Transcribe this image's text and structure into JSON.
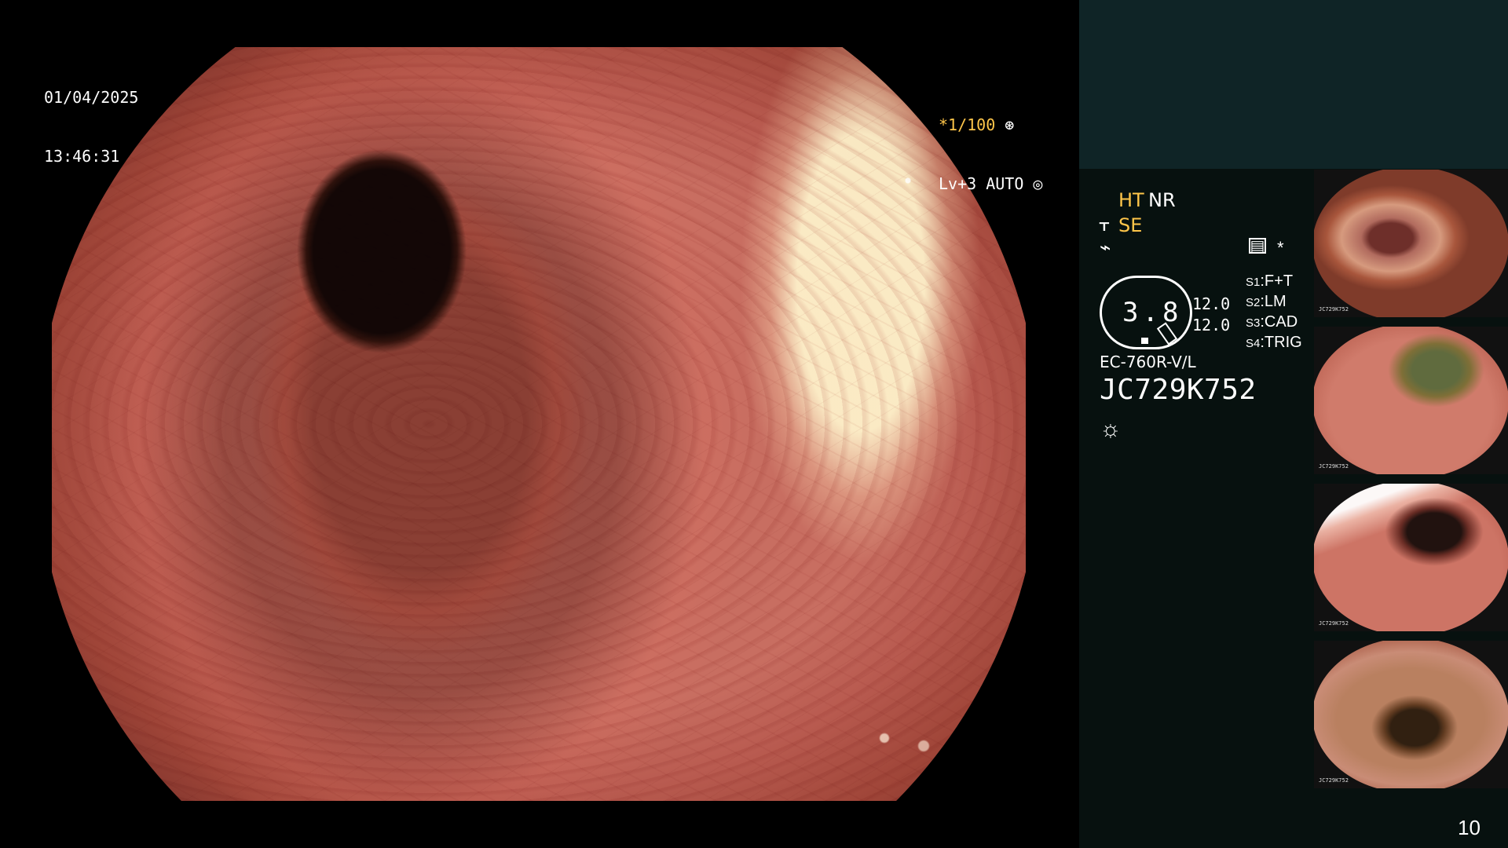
{
  "overlay": {
    "date": "01/04/2025",
    "time": "13:46:31",
    "exposure": "*1/100",
    "mode": "Lv+3 AUTO"
  },
  "status": {
    "ht": "HT",
    "nr": "NR",
    "se": "SE",
    "ring_value": "3.8",
    "value_top": "12.0",
    "value_bottom": "12.0",
    "settings": [
      {
        "key": "S1",
        "value": "F+T"
      },
      {
        "key": "S2",
        "value": "LM"
      },
      {
        "key": "S3",
        "value": "CAD"
      },
      {
        "key": "S4",
        "value": "TRIG"
      }
    ],
    "model": "EC-760R-V/L",
    "serial": "JC729K752"
  },
  "thumbnails": [
    {
      "meta": "JC729K752"
    },
    {
      "meta": "JC729K752"
    },
    {
      "meta": "JC729K752"
    },
    {
      "meta": "JC729K752"
    }
  ],
  "page_number": "10",
  "icons": {
    "shutter": "aperture-icon",
    "light": "sun-icon",
    "settings": "memory-icon",
    "star": "asterisk-icon"
  },
  "colors": {
    "amber": "#ffc64a",
    "panel_dark": "#07110f",
    "panel_top": "#0f2426"
  }
}
